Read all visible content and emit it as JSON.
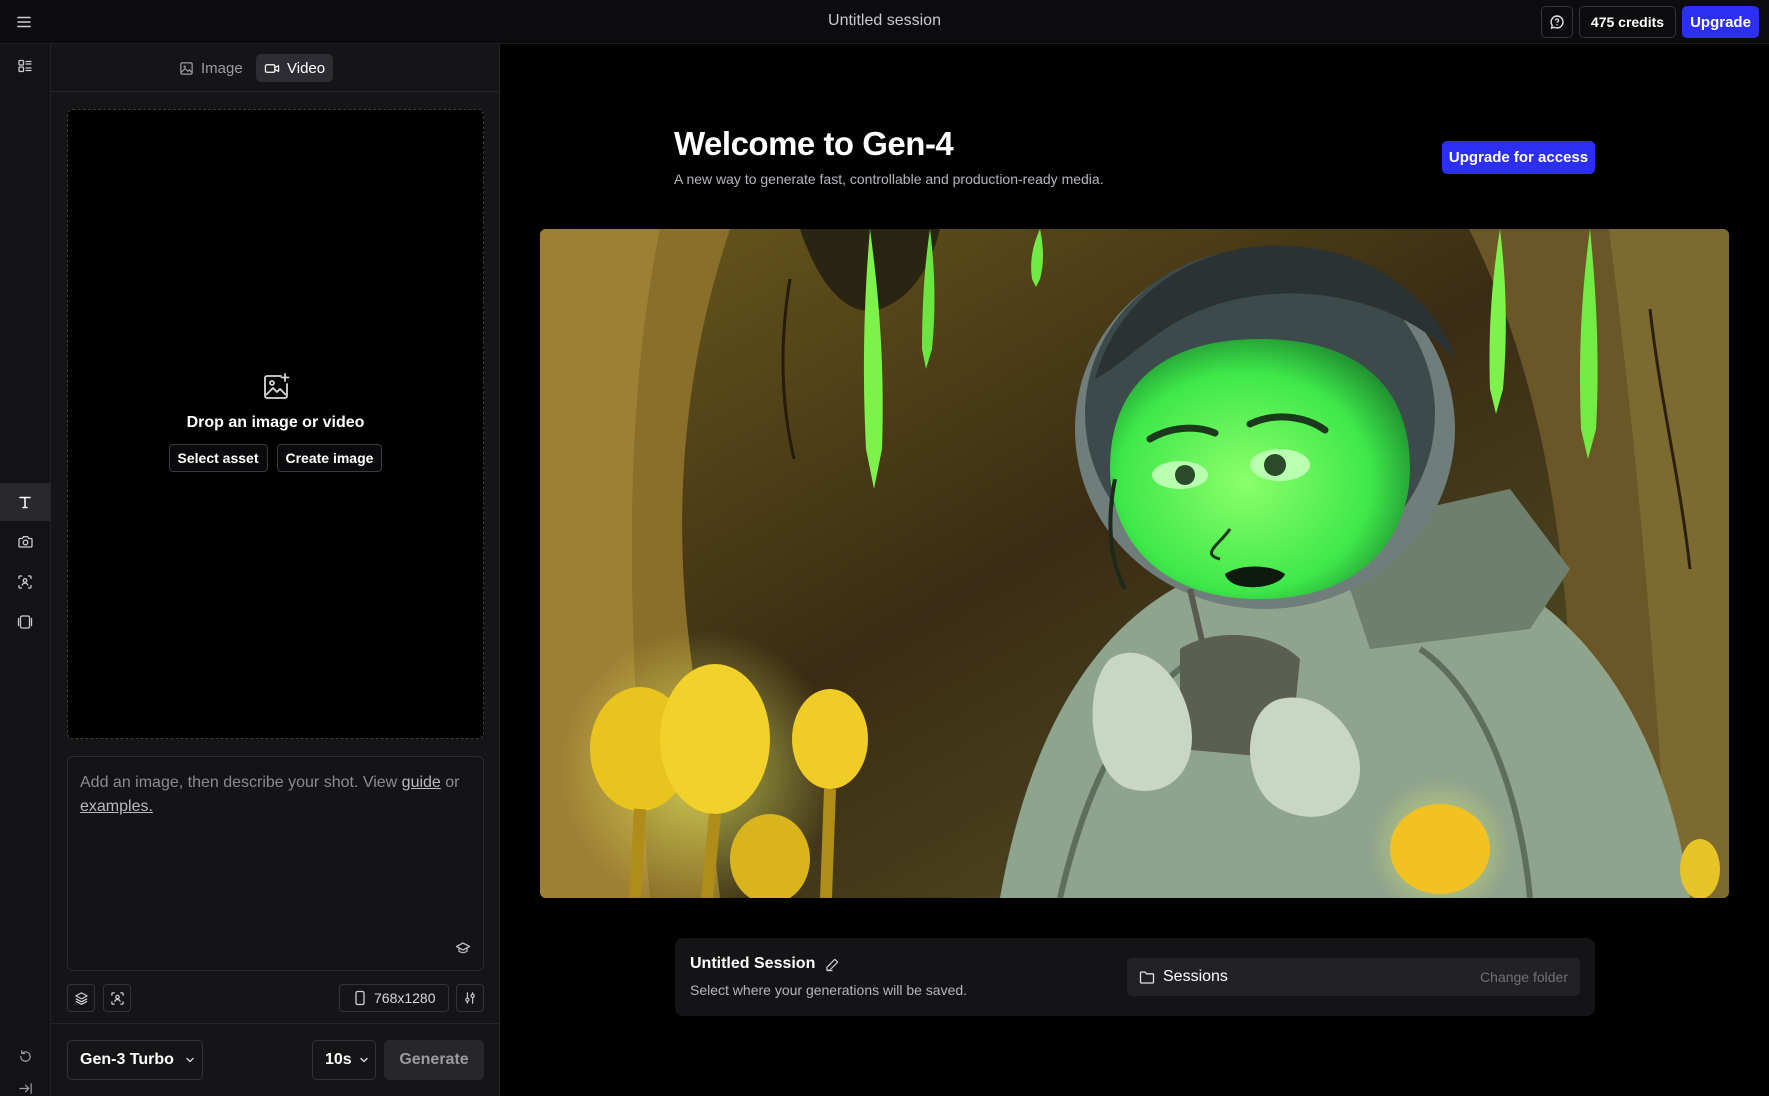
{
  "topbar": {
    "session_title": "Untitled session",
    "credits": "475 credits",
    "upgrade_label": "Upgrade"
  },
  "mode_tabs": [
    {
      "label": "Image",
      "active": false
    },
    {
      "label": "Video",
      "active": true
    }
  ],
  "dropzone": {
    "title": "Drop an image or video",
    "select_asset": "Select asset",
    "create_image": "Create image"
  },
  "prompt": {
    "text_before": "Add an image, then describe your shot. View ",
    "guide_link": "guide",
    "text_middle": " or ",
    "examples_link": "examples."
  },
  "controls": {
    "resolution": "768x1280",
    "model": "Gen-3 Turbo",
    "duration": "10s",
    "generate_label": "Generate"
  },
  "welcome": {
    "title": "Welcome to Gen-4",
    "subtitle": "A new way to generate fast, controllable and production-ready media.",
    "upgrade_access": "Upgrade for access"
  },
  "session_card": {
    "title": "Untitled Session",
    "subtitle": "Select where your generations will be saved.",
    "folder_name": "Sessions",
    "change_folder": "Change folder"
  },
  "colors": {
    "accent": "#2c2ff2",
    "background": "#000000",
    "panel": "#151518"
  }
}
